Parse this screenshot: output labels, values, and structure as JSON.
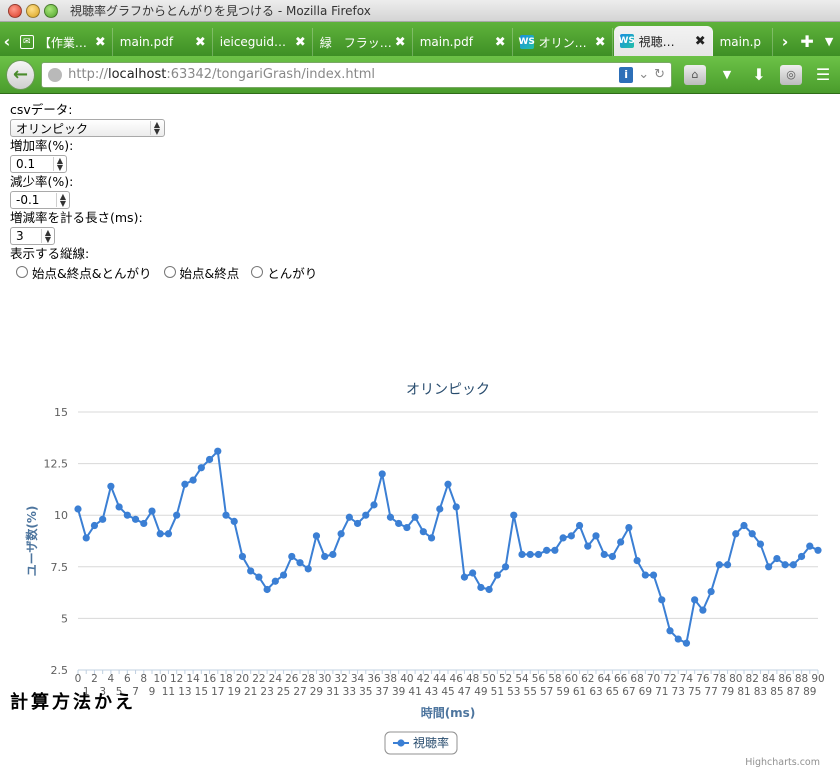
{
  "window": {
    "title": "視聴率グラフからとんがりを見つける - Mozilla Firefox"
  },
  "tabs": [
    {
      "label": "【作業…",
      "icon": "mail-icon",
      "active": false
    },
    {
      "label": "main.pdf",
      "icon": "",
      "active": false
    },
    {
      "label": "ieiceguid…",
      "icon": "",
      "active": false
    },
    {
      "label": "緑　フラッ…",
      "icon": "",
      "active": false
    },
    {
      "label": "main.pdf",
      "icon": "",
      "active": false
    },
    {
      "label": "オリン…",
      "icon": "ws-icon",
      "active": false
    },
    {
      "label": "視聴…",
      "icon": "ws-icon",
      "active": true
    },
    {
      "label": "main.p",
      "icon": "",
      "active": false
    }
  ],
  "tab_close_glyph": "✖",
  "favicon_ws_text": "WS",
  "toolbar": {
    "url_prefix": "http://",
    "url_host": "localhost",
    "url_rest": ":63342/tongariGrash/index.html"
  },
  "form": {
    "csv_label": "csvデータ:",
    "csv_value": "オリンピック",
    "increase_label": "増加率(%):",
    "increase_value": "0.1",
    "decrease_label": "減少率(%):",
    "decrease_value": "-0.1",
    "length_label": "増減率を計る長さ(ms):",
    "length_value": "3",
    "lines_label": "表示する縦線:",
    "radio_options": [
      "始点&終点&とんがり",
      "始点&終点",
      "とんがり"
    ]
  },
  "chart_data": {
    "type": "line",
    "title": "オリンピック",
    "xlabel": "時間(ms)",
    "ylabel": "ユーザ数(%)",
    "ylim": [
      2.5,
      15
    ],
    "yticks": [
      2.5,
      5,
      7.5,
      10,
      12.5,
      15
    ],
    "yticklabels": [
      "2.5",
      "5",
      "7.5",
      "10",
      "12.5",
      "15"
    ],
    "grid": true,
    "legend": "bottom-center",
    "credits": "Highcharts.com",
    "series": [
      {
        "name": "視聴率",
        "color": "#3b7fd4",
        "x": [
          0,
          1,
          2,
          3,
          4,
          5,
          6,
          7,
          8,
          9,
          10,
          11,
          12,
          13,
          14,
          15,
          16,
          17,
          18,
          19,
          20,
          21,
          22,
          23,
          24,
          25,
          26,
          27,
          28,
          29,
          30,
          31,
          32,
          33,
          34,
          35,
          36,
          37,
          38,
          39,
          40,
          41,
          42,
          43,
          44,
          45,
          46,
          47,
          48,
          49,
          50,
          51,
          52,
          53,
          54,
          55,
          56,
          57,
          58,
          59,
          60,
          61,
          62,
          63,
          64,
          65,
          66,
          67,
          68,
          69,
          70,
          71,
          72,
          73,
          74,
          75,
          76,
          77,
          78,
          79,
          80,
          81,
          82,
          83,
          84,
          85,
          86,
          87,
          88,
          89,
          90
        ],
        "values": [
          10.3,
          8.9,
          9.5,
          9.8,
          11.4,
          10.4,
          10.0,
          9.8,
          9.6,
          10.2,
          9.1,
          9.1,
          10.0,
          11.5,
          11.7,
          12.3,
          12.7,
          13.1,
          10.0,
          9.7,
          8.0,
          7.3,
          7.0,
          6.4,
          6.8,
          7.1,
          8.0,
          7.7,
          7.4,
          9.0,
          8.0,
          8.1,
          9.1,
          9.9,
          9.6,
          10.0,
          10.5,
          12.0,
          9.9,
          9.6,
          9.4,
          9.9,
          9.2,
          8.9,
          10.3,
          11.5,
          10.4,
          7.0,
          7.2,
          6.5,
          6.4,
          7.1,
          7.5,
          10.0,
          8.1,
          8.1,
          8.1,
          8.3,
          8.3,
          8.9,
          9.0,
          9.5,
          8.5,
          9.0,
          8.1,
          8.0,
          8.7,
          9.4,
          7.8,
          7.1,
          7.1,
          5.9,
          4.4,
          4.0,
          3.8,
          5.9,
          5.4,
          6.3,
          7.6,
          7.6,
          9.1,
          9.5,
          9.1,
          8.6,
          7.5,
          7.9,
          7.6,
          7.6,
          8.0,
          8.5,
          8.3
        ]
      }
    ]
  },
  "section": {
    "heading": "計算方法かえ"
  }
}
